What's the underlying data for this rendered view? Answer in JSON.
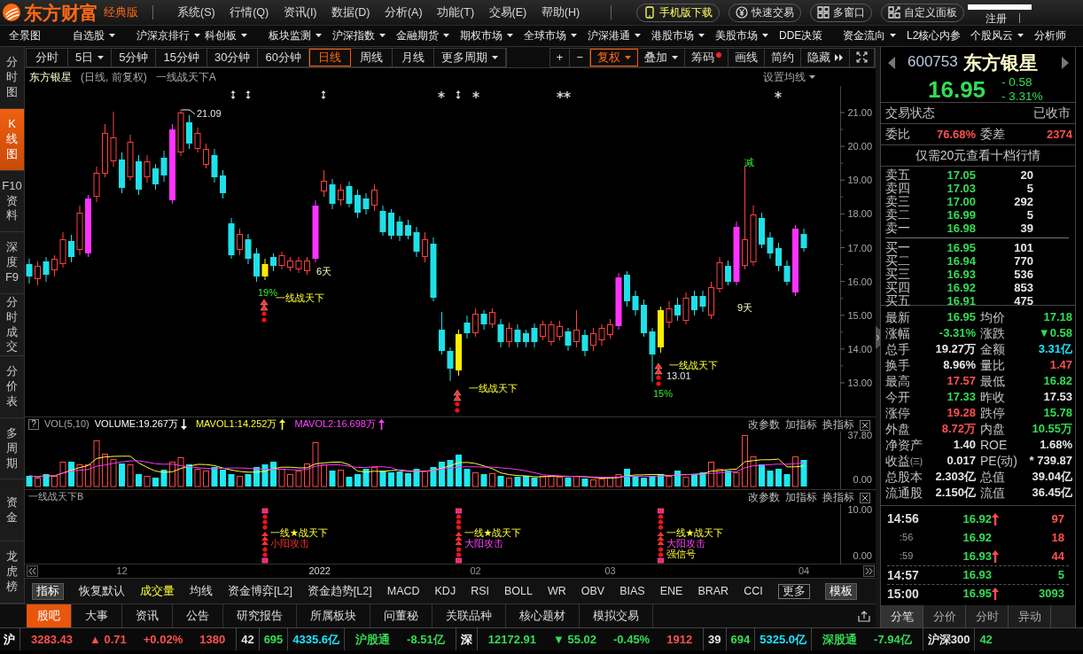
{
  "title_bar": {
    "logo": "东方财富",
    "edition": "经典版",
    "menus": [
      "系统(S)",
      "行情(Q)",
      "资讯(I)",
      "数据(D)",
      "分析(A)",
      "功能(T)",
      "交易(E)",
      "帮助(H)"
    ],
    "buttons": [
      {
        "label": "手机版下载",
        "kind": "mobile"
      },
      {
        "label": "快速交易",
        "kind": "trade"
      },
      {
        "label": "多窗口",
        "kind": "windows"
      },
      {
        "label": "自定义面板",
        "kind": "panel"
      }
    ],
    "links": [
      "注册"
    ]
  },
  "market_nav": [
    {
      "label": "全景图",
      "dropdown": false
    },
    {
      "label": "自选股",
      "dropdown": true
    },
    {
      "label": "沪深京排行",
      "dropdown": true
    },
    {
      "label": "科创板",
      "dropdown": true
    },
    {
      "label": "板块监测",
      "dropdown": true
    },
    {
      "label": "沪深指数",
      "dropdown": true
    },
    {
      "label": "金融期货",
      "dropdown": true
    },
    {
      "label": "期权市场",
      "dropdown": true
    },
    {
      "label": "全球市场",
      "dropdown": true
    },
    {
      "label": "沪深港通",
      "dropdown": true
    },
    {
      "label": "港股市场",
      "dropdown": true
    },
    {
      "label": "美股市场",
      "dropdown": true
    },
    {
      "label": "DDE决策",
      "dropdown": false
    },
    {
      "label": "资金流向",
      "dropdown": true
    },
    {
      "label": "L2核心内参",
      "dropdown": false
    },
    {
      "label": "个股风云",
      "dropdown": true
    },
    {
      "label": "分析师",
      "dropdown": false
    }
  ],
  "side_tabs": [
    {
      "label": "分时图",
      "selected": false
    },
    {
      "label": "K线图",
      "selected": true
    },
    {
      "label": "F10资料",
      "selected": false
    },
    {
      "label": "深度F9",
      "selected": false
    },
    {
      "label": "分时成交",
      "selected": false
    },
    {
      "label": "分价表",
      "selected": false
    },
    {
      "label": "多周期",
      "selected": false
    },
    {
      "label": "资金",
      "selected": false
    },
    {
      "label": "龙虎榜",
      "selected": false
    }
  ],
  "period_bar": {
    "periods": [
      {
        "label": "分时",
        "dropdown": false,
        "selected": false
      },
      {
        "label": "5日",
        "dropdown": true,
        "selected": false
      },
      {
        "label": "5分钟",
        "dropdown": false,
        "selected": false
      },
      {
        "label": "15分钟",
        "dropdown": false,
        "selected": false
      },
      {
        "label": "30分钟",
        "dropdown": false,
        "selected": false
      },
      {
        "label": "60分钟",
        "dropdown": false,
        "selected": false
      },
      {
        "label": "日线",
        "dropdown": false,
        "selected": true
      },
      {
        "label": "周线",
        "dropdown": false,
        "selected": false
      },
      {
        "label": "月线",
        "dropdown": false,
        "selected": false
      },
      {
        "label": "更多周期",
        "dropdown": true,
        "selected": false
      }
    ],
    "tools": [
      {
        "label": "+",
        "kind": "plain",
        "dropdown": false,
        "active": false,
        "alert": false
      },
      {
        "label": "−",
        "kind": "plain",
        "dropdown": false,
        "active": false,
        "alert": false
      },
      {
        "label": "复权",
        "kind": "plain",
        "dropdown": true,
        "active": true,
        "alert": false
      },
      {
        "label": "叠加",
        "kind": "plain",
        "dropdown": true,
        "active": false,
        "alert": false
      },
      {
        "label": "筹码",
        "kind": "plain",
        "dropdown": false,
        "active": false,
        "alert": true
      },
      {
        "label": "画线",
        "kind": "plain",
        "dropdown": false,
        "active": false,
        "alert": false
      },
      {
        "label": "简约",
        "kind": "plain",
        "dropdown": false,
        "active": false,
        "alert": false
      },
      {
        "label": "隐藏",
        "kind": "expand",
        "dropdown": false,
        "active": false,
        "alert": false
      }
    ]
  },
  "price_chart": {
    "stock": "东方银星",
    "info": "(日线, 前复权)",
    "formula": "一线战天下A",
    "settings": "设置均线",
    "price_ticks": [
      "21.00",
      "20.00",
      "19.00",
      "18.00",
      "17.00",
      "16.00",
      "15.00",
      "14.00",
      "13.00"
    ],
    "annotations": [
      {
        "kind": "price",
        "text": "21.09"
      },
      {
        "kind": "days",
        "text": "6天"
      },
      {
        "kind": "pct",
        "text": "19%"
      },
      {
        "kind": "signal",
        "text": "一线战天下"
      },
      {
        "kind": "signal",
        "text": "一线战天下"
      },
      {
        "kind": "days",
        "text": "9天"
      },
      {
        "kind": "cut",
        "text": "减"
      },
      {
        "kind": "signal",
        "text": "一线战天下"
      },
      {
        "kind": "price",
        "text": "13.01"
      },
      {
        "kind": "pct",
        "text": "15%"
      }
    ]
  },
  "volume_panel": {
    "help": "?",
    "name": "VOL(5,10)",
    "readings": [
      {
        "kind": "volume",
        "text": "VOLUME:19.267万",
        "up": false
      },
      {
        "kind": "ma1",
        "text": "MAVOL1:14.252万",
        "up": true
      },
      {
        "kind": "ma2",
        "text": "MAVOL2:16.698万",
        "up": true
      }
    ],
    "actions": [
      "改参数",
      "加指标",
      "换指标"
    ],
    "ticks": [
      "37.80",
      "0.00"
    ]
  },
  "signal_panel": {
    "name": "一线战天下B",
    "actions": [
      "改参数",
      "加指标",
      "换指标"
    ],
    "ticks": [
      "10.00",
      "0.00"
    ],
    "signals": [
      {
        "title": "一线★战天下",
        "label": "小阳攻击",
        "kind": "small"
      },
      {
        "title": "一线★战天下",
        "label": "大阳攻击",
        "kind": "big"
      },
      {
        "title": "一线★战天下",
        "label": "大阳攻击",
        "kind": "big",
        "note": "强信号"
      }
    ]
  },
  "date_axis": [
    "12",
    "2022",
    "02",
    "03",
    "04"
  ],
  "indicator_bar": {
    "button": "指标",
    "items": [
      {
        "label": "恢复默认",
        "selected": false
      },
      {
        "label": "成交量",
        "selected": true
      },
      {
        "label": "均线",
        "selected": false
      },
      {
        "label": "资金博弈[L2]",
        "selected": false
      },
      {
        "label": "资金趋势[L2]",
        "selected": false
      },
      {
        "label": "MACD",
        "selected": false
      },
      {
        "label": "KDJ",
        "selected": false
      },
      {
        "label": "RSI",
        "selected": false
      },
      {
        "label": "BOLL",
        "selected": false
      },
      {
        "label": "WR",
        "selected": false
      },
      {
        "label": "OBV",
        "selected": false
      },
      {
        "label": "BIAS",
        "selected": false
      },
      {
        "label": "ENE",
        "selected": false
      },
      {
        "label": "BRAR",
        "selected": false
      },
      {
        "label": "CCI",
        "selected": false
      }
    ],
    "more": "更多",
    "template": "模板"
  },
  "info_tabs": [
    {
      "label": "股吧",
      "selected": true
    },
    {
      "label": "大事",
      "selected": false
    },
    {
      "label": "资讯",
      "selected": false
    },
    {
      "label": "公告",
      "selected": false
    },
    {
      "label": "研究报告",
      "selected": false
    },
    {
      "label": "所属板块",
      "selected": false
    },
    {
      "label": "问董秘",
      "selected": false
    },
    {
      "label": "关联品种",
      "selected": false
    },
    {
      "label": "核心题材",
      "selected": false
    },
    {
      "label": "模拟交易",
      "selected": false
    }
  ],
  "quote": {
    "code": "600753",
    "name": "东方银星",
    "price": "16.95",
    "change": "- 0.58",
    "change_pct": "- 3.31%",
    "color": "#33dd55",
    "status_label": "交易状态",
    "status": "已收市",
    "ratio": [
      {
        "label": "委比",
        "value": "76.68%",
        "color": "#ff5050"
      },
      {
        "label": "委差",
        "value": "2374",
        "color": "#ff5050"
      }
    ],
    "promo": "仅需20元查看十档行情",
    "asks": [
      {
        "label": "卖五",
        "price": "17.05",
        "volume": "20",
        "color": "#33dd55"
      },
      {
        "label": "卖四",
        "price": "17.03",
        "volume": "5",
        "color": "#33dd55"
      },
      {
        "label": "卖三",
        "price": "17.00",
        "volume": "292",
        "color": "#33dd55"
      },
      {
        "label": "卖二",
        "price": "16.99",
        "volume": "5",
        "color": "#33dd55"
      },
      {
        "label": "卖一",
        "price": "16.98",
        "volume": "39",
        "color": "#33dd55"
      }
    ],
    "bids": [
      {
        "label": "买一",
        "price": "16.95",
        "volume": "101",
        "color": "#33dd55"
      },
      {
        "label": "买二",
        "price": "16.94",
        "volume": "770",
        "color": "#33dd55"
      },
      {
        "label": "买三",
        "price": "16.93",
        "volume": "536",
        "color": "#33dd55"
      },
      {
        "label": "买四",
        "price": "16.92",
        "volume": "853",
        "color": "#33dd55"
      },
      {
        "label": "买五",
        "price": "16.91",
        "volume": "475",
        "color": "#33dd55"
      }
    ],
    "stats": [
      {
        "label": "最新",
        "value": "16.95",
        "color": "#33dd55"
      },
      {
        "label": "均价",
        "value": "17.18",
        "color": "#33dd55"
      },
      {
        "label": "涨幅",
        "value": "-3.31%",
        "color": "#33dd55"
      },
      {
        "label": "涨跌",
        "value": "▼0.58",
        "color": "#33dd55"
      },
      {
        "label": "总手",
        "value": "19.27万",
        "color": "#e6e6e6"
      },
      {
        "label": "金额",
        "value": "3.31亿",
        "color": "#19e6ff"
      },
      {
        "label": "换手",
        "value": "8.96%",
        "color": "#e6e6e6"
      },
      {
        "label": "量比",
        "value": "1.47",
        "color": "#ff5050"
      },
      {
        "label": "最高",
        "value": "17.57",
        "color": "#ff5050"
      },
      {
        "label": "最低",
        "value": "16.82",
        "color": "#33dd55"
      },
      {
        "label": "今开",
        "value": "17.33",
        "color": "#33dd55"
      },
      {
        "label": "昨收",
        "value": "17.53",
        "color": "#e6e6e6"
      },
      {
        "label": "涨停",
        "value": "19.28",
        "color": "#ff5050"
      },
      {
        "label": "跌停",
        "value": "15.78",
        "color": "#33dd55"
      },
      {
        "label": "外盘",
        "value": "8.72万",
        "color": "#ff5050"
      },
      {
        "label": "内盘",
        "value": "10.55万",
        "color": "#33dd55"
      },
      {
        "label": "净资产",
        "value": "1.40",
        "color": "#e6e6e6"
      },
      {
        "label": "ROE",
        "value": "1.68%",
        "color": "#e6e6e6"
      },
      {
        "label": "收益㈢",
        "value": "0.017",
        "color": "#e6e6e6"
      },
      {
        "label": "PE(动)",
        "value": "* 739.87",
        "color": "#e6e6e6"
      },
      {
        "label": "总股本",
        "value": "2.303亿",
        "color": "#e6e6e6"
      },
      {
        "label": "总值",
        "value": "39.04亿",
        "color": "#e6e6e6"
      },
      {
        "label": "流通股",
        "value": "2.150亿",
        "color": "#e6e6e6"
      },
      {
        "label": "流值",
        "value": "36.45亿",
        "color": "#e6e6e6"
      }
    ],
    "ticks": [
      {
        "time": "14:56",
        "kind": "minute",
        "price": {
          "text": "16.92",
          "color": "#33dd55"
        },
        "arrow": true,
        "volume": {
          "text": "97",
          "color": "#ff5050"
        }
      },
      {
        "time": ":56",
        "kind": "second",
        "price": {
          "text": "16.92",
          "color": "#33dd55"
        },
        "arrow": false,
        "volume": {
          "text": "18",
          "color": "#ff5050"
        }
      },
      {
        "time": ":59",
        "kind": "second",
        "price": {
          "text": "16.93",
          "color": "#33dd55"
        },
        "arrow": true,
        "volume": {
          "text": "44",
          "color": "#ff5050"
        }
      },
      {
        "time": "14:57",
        "kind": "minute",
        "price": {
          "text": "16.93",
          "color": "#33dd55"
        },
        "arrow": false,
        "volume": {
          "text": "5",
          "color": "#33dd55"
        }
      },
      {
        "time": "15:00",
        "kind": "minute",
        "price": {
          "text": "16.95",
          "color": "#33dd55"
        },
        "arrow": true,
        "volume": {
          "text": "3093",
          "color": "#33dd55"
        }
      }
    ],
    "tabs": [
      {
        "label": "分笔",
        "selected": true
      },
      {
        "label": "分价",
        "selected": false
      },
      {
        "label": "分时",
        "selected": false
      },
      {
        "label": "异动",
        "selected": false
      }
    ]
  },
  "status_bar": [
    [
      {
        "text": "沪",
        "color": "#ffffff"
      }
    ],
    [
      {
        "text": "3283.43",
        "color": "#ff5050"
      },
      {
        "text": "▲ 0.71",
        "color": "#ff5050"
      },
      {
        "text": "+0.02%",
        "color": "#ff5050"
      },
      {
        "text": "1380",
        "color": "#ff5050"
      }
    ],
    [
      {
        "text": "42",
        "color": "#e6e6e6"
      }
    ],
    [
      {
        "text": "695",
        "color": "#33dd55"
      }
    ],
    [
      {
        "text": "4335.6亿",
        "color": "#19e6ff"
      }
    ],
    [
      {
        "text": "沪股通",
        "color": "#33dd55"
      },
      {
        "text": "-8.51亿",
        "color": "#33dd55"
      }
    ],
    [
      {
        "text": "深",
        "color": "#ffffff"
      }
    ],
    [
      {
        "text": "12172.91",
        "color": "#33dd55"
      },
      {
        "text": "▼ 55.02",
        "color": "#33dd55"
      },
      {
        "text": "-0.45%",
        "color": "#33dd55"
      },
      {
        "text": "1912",
        "color": "#ff5050"
      }
    ],
    [
      {
        "text": "39",
        "color": "#e6e6e6"
      }
    ],
    [
      {
        "text": "694",
        "color": "#33dd55"
      }
    ],
    [
      {
        "text": "5325.0亿",
        "color": "#19e6ff"
      }
    ],
    [
      {
        "text": "深股通",
        "color": "#33dd55"
      },
      {
        "text": "-7.94亿",
        "color": "#33dd55"
      }
    ],
    [
      {
        "text": "沪深300",
        "color": "#e6e6e6"
      }
    ],
    [
      {
        "text": "42",
        "color": "#33dd55"
      }
    ]
  ]
}
